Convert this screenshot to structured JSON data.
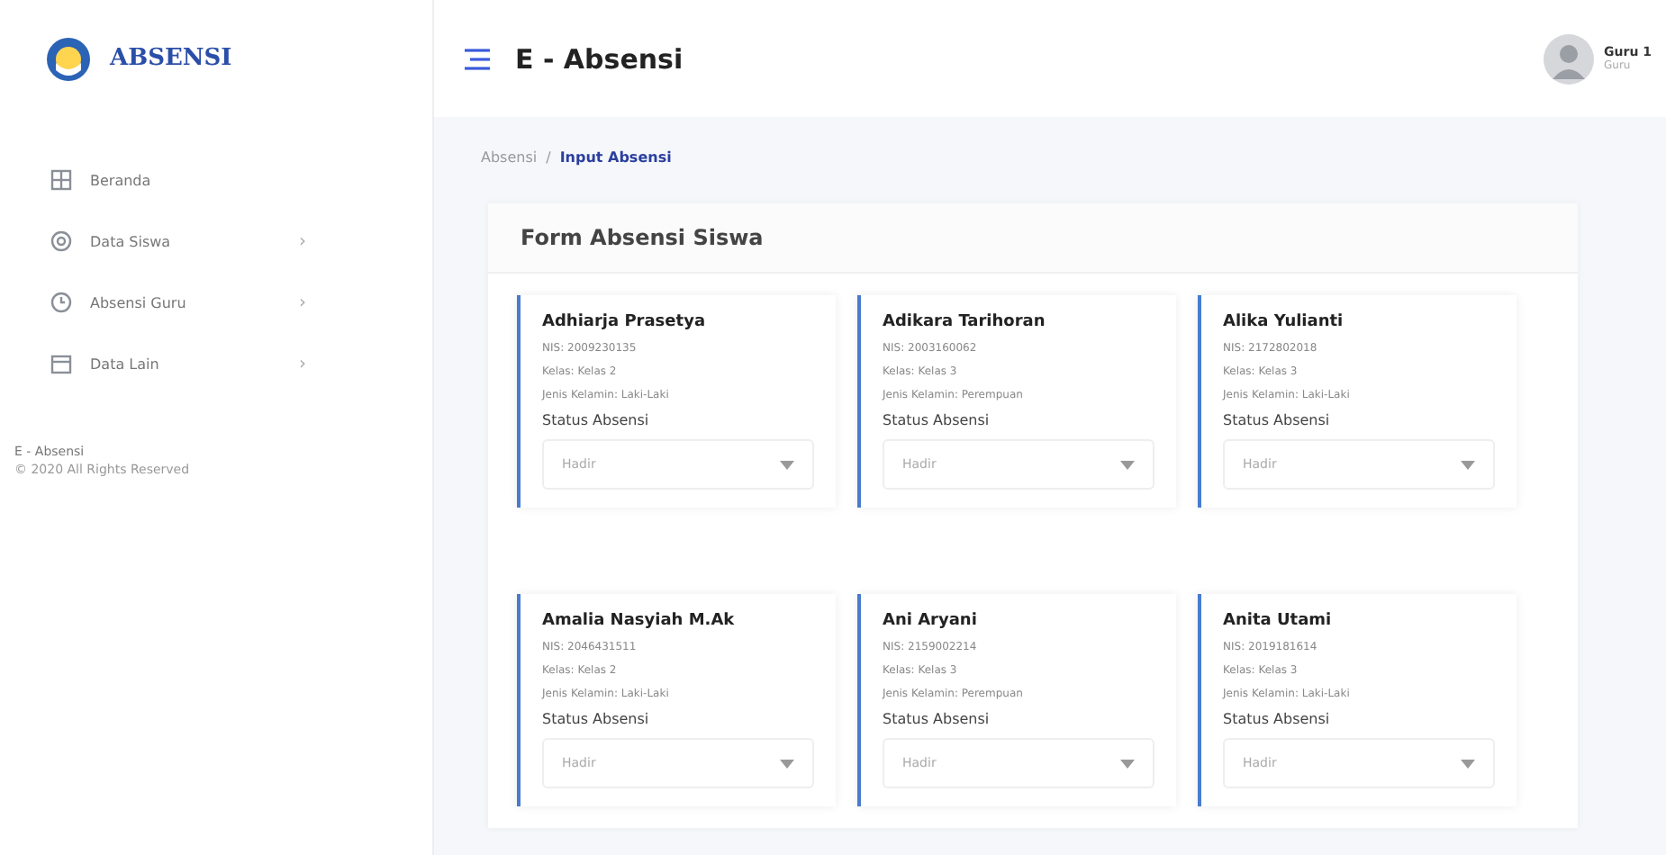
{
  "brand": {
    "name": "ABSENSI"
  },
  "sidebar": {
    "items": [
      {
        "label": "Beranda",
        "kind": "grid"
      },
      {
        "label": "Data Siswa",
        "kind": "gear",
        "chevron": "›"
      },
      {
        "label": "Absensi Guru",
        "kind": "clock",
        "chevron": "›"
      },
      {
        "label": "Data Lain",
        "kind": "calendar",
        "chevron": "›"
      }
    ],
    "footer": {
      "title": "E - Absensi",
      "copyright": "© 2020 All Rights Reserved"
    }
  },
  "header": {
    "title": "E - Absensi",
    "user": {
      "name": "Guru 1",
      "role": "Guru"
    }
  },
  "breadcrumb": [
    {
      "label": "Absensi",
      "selected": false
    },
    {
      "label": "Input Absensi",
      "selected": true
    }
  ],
  "breadcrumb_separator": "/",
  "form": {
    "title": "Form Absensi Siswa",
    "students": [
      {
        "name": "Adhiarja Prasetya",
        "nis": "NIS: 2009230135",
        "kelas": "Kelas: Kelas 2",
        "gender": "Jenis Kelamin: Laki-Laki",
        "status_label": "Status Absensi",
        "status": "Hadir"
      },
      {
        "name": "Adikara Tarihoran",
        "nis": "NIS: 2003160062",
        "kelas": "Kelas: Kelas 3",
        "gender": "Jenis Kelamin: Perempuan",
        "status_label": "Status Absensi",
        "status": "Hadir"
      },
      {
        "name": "Alika Yulianti",
        "nis": "NIS: 2172802018",
        "kelas": "Kelas: Kelas 3",
        "gender": "Jenis Kelamin: Laki-Laki",
        "status_label": "Status Absensi",
        "status": "Hadir"
      },
      {
        "name": "Amalia Nasyiah M.Ak",
        "nis": "NIS: 2046431511",
        "kelas": "Kelas: Kelas 2",
        "gender": "Jenis Kelamin: Laki-Laki",
        "status_label": "Status Absensi",
        "status": "Hadir"
      },
      {
        "name": "Ani Aryani",
        "nis": "NIS: 2159002214",
        "kelas": "Kelas: Kelas 3",
        "gender": "Jenis Kelamin: Perempuan",
        "status_label": "Status Absensi",
        "status": "Hadir"
      },
      {
        "name": "Anita Utami",
        "nis": "NIS: 2019181614",
        "kelas": "Kelas: Kelas 3",
        "gender": "Jenis Kelamin: Laki-Laki",
        "status_label": "Status Absensi",
        "status": "Hadir"
      }
    ]
  }
}
